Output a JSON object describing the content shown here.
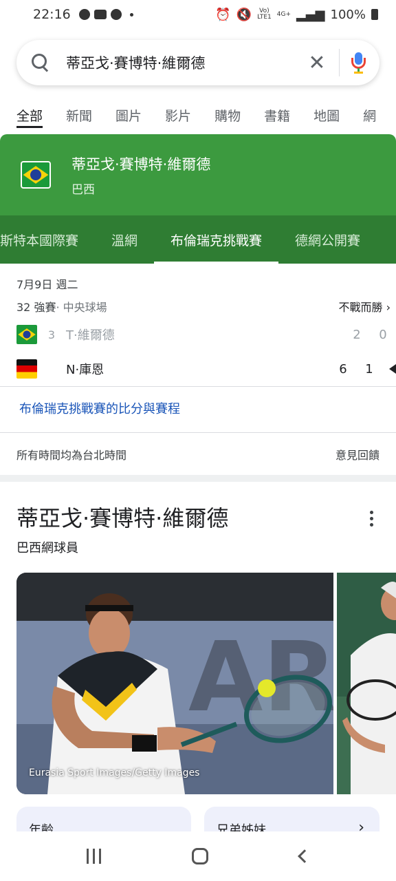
{
  "status_bar": {
    "time": "22:16",
    "left_icons": [
      "chrome-icon",
      "youtube-icon",
      "clock-icon"
    ],
    "network_top": "Vo)",
    "network_bottom": "LTE1",
    "data_type": "4G+",
    "battery": "100%"
  },
  "search": {
    "query": "蒂亞戈·賽博特·維爾德",
    "clear_symbol": "✕"
  },
  "tabs": [
    {
      "label": "全部",
      "active": true
    },
    {
      "label": "新聞",
      "active": false
    },
    {
      "label": "圖片",
      "active": false
    },
    {
      "label": "影片",
      "active": false
    },
    {
      "label": "購物",
      "active": false
    },
    {
      "label": "書籍",
      "active": false
    },
    {
      "label": "地圖",
      "active": false
    },
    {
      "label": "網",
      "active": false
    }
  ],
  "sports_card": {
    "player": "蒂亞戈·賽博特·維爾德",
    "country": "巴西",
    "tournament_tabs": [
      "斯特本國際賽",
      "溫網",
      "布倫瑞克挑戰賽",
      "德網公開賽"
    ],
    "active_tab_index": 2
  },
  "match": {
    "date": "7月9日 週二",
    "round": "32 強賽",
    "court": " · 中央球場",
    "result_text": "不戰而勝",
    "players": [
      {
        "seed": "3",
        "name": "T·維爾德",
        "scores": [
          "2",
          "0"
        ],
        "winner": false
      },
      {
        "seed": "",
        "name": "N·庫恩",
        "scores": [
          "6",
          "1"
        ],
        "winner": true
      }
    ]
  },
  "scores_link": "布倫瑞克挑戰賽的比分與賽程",
  "footer": {
    "timezone_note": "所有時間均為台北時間",
    "feedback": "意見回饋"
  },
  "knowledge_panel": {
    "title": "蒂亞戈·賽博特·維爾德",
    "subtitle": "巴西網球員",
    "photo_credit": "Eurasia Sport Images/Getty Images",
    "chips": [
      {
        "label": "年齡"
      },
      {
        "label": "兄弟姊妹"
      }
    ]
  },
  "colors": {
    "green_header": "#3c9a3f",
    "green_tabs": "#2f7d33",
    "link_blue": "#1a55b8"
  }
}
